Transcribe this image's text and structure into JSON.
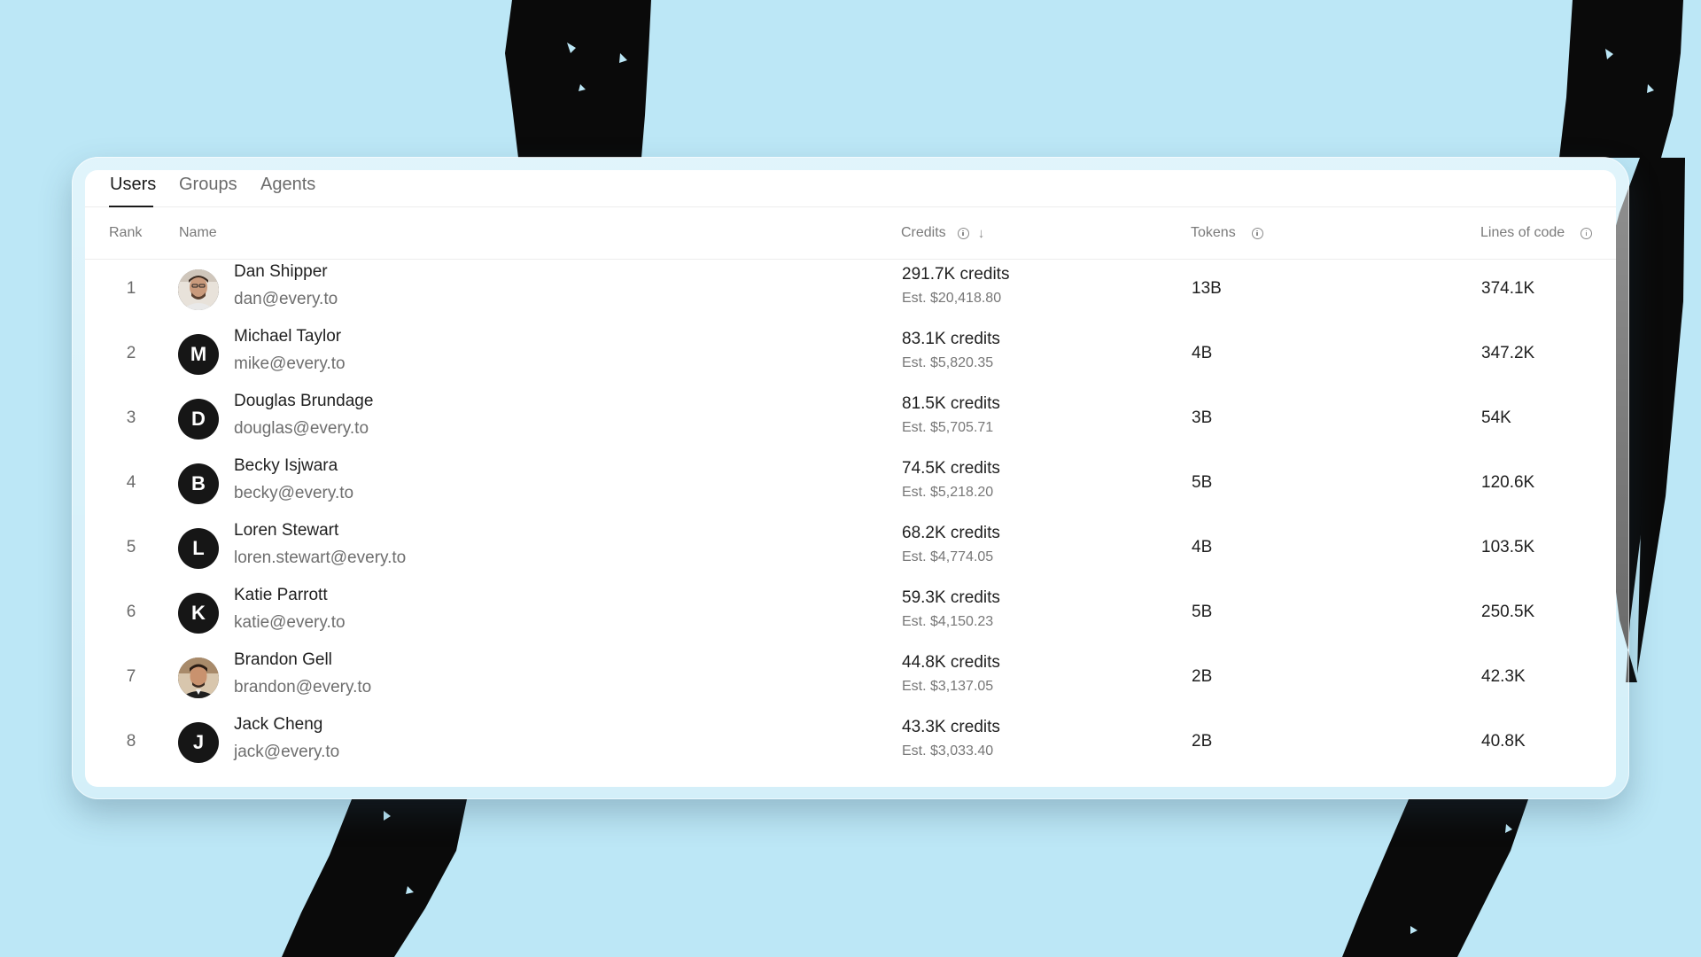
{
  "tabs": [
    {
      "label": "Users",
      "active": true
    },
    {
      "label": "Groups",
      "active": false
    },
    {
      "label": "Agents",
      "active": false
    }
  ],
  "columns": {
    "rank": "Rank",
    "name": "Name",
    "credits": "Credits",
    "tokens": "Tokens",
    "lines_of_code": "Lines of code"
  },
  "icons": {
    "info": "info-circle-icon",
    "sort": "arrow-down-icon"
  },
  "rows": [
    {
      "rank": "1",
      "name": "Dan Shipper",
      "email": "dan@every.to",
      "avatar": "photo",
      "credits": "291.7K credits",
      "est": "Est. $20,418.80",
      "tokens": "13B",
      "loc": "374.1K"
    },
    {
      "rank": "2",
      "name": "Michael Taylor",
      "email": "mike@every.to",
      "avatar": "M",
      "credits": "83.1K credits",
      "est": "Est. $5,820.35",
      "tokens": "4B",
      "loc": "347.2K"
    },
    {
      "rank": "3",
      "name": "Douglas Brundage",
      "email": "douglas@every.to",
      "avatar": "D",
      "credits": "81.5K credits",
      "est": "Est. $5,705.71",
      "tokens": "3B",
      "loc": "54K"
    },
    {
      "rank": "4",
      "name": "Becky Isjwara",
      "email": "becky@every.to",
      "avatar": "B",
      "credits": "74.5K credits",
      "est": "Est. $5,218.20",
      "tokens": "5B",
      "loc": "120.6K"
    },
    {
      "rank": "5",
      "name": "Loren Stewart",
      "email": "loren.stewart@every.to",
      "avatar": "L",
      "credits": "68.2K credits",
      "est": "Est. $4,774.05",
      "tokens": "4B",
      "loc": "103.5K"
    },
    {
      "rank": "6",
      "name": "Katie Parrott",
      "email": "katie@every.to",
      "avatar": "K",
      "credits": "59.3K credits",
      "est": "Est. $4,150.23",
      "tokens": "5B",
      "loc": "250.5K"
    },
    {
      "rank": "7",
      "name": "Brandon Gell",
      "email": "brandon@every.to",
      "avatar": "photo",
      "credits": "44.8K credits",
      "est": "Est. $3,137.05",
      "tokens": "2B",
      "loc": "42.3K"
    },
    {
      "rank": "8",
      "name": "Jack Cheng",
      "email": "jack@every.to",
      "avatar": "J",
      "credits": "43.3K credits",
      "est": "Est. $3,033.40",
      "tokens": "2B",
      "loc": "40.8K"
    }
  ],
  "colors": {
    "background": "#bce7f6",
    "brush": "#0a0a0a",
    "avatar": "#161616",
    "text": "#1f1f1f",
    "muted": "#6e6e6e"
  }
}
